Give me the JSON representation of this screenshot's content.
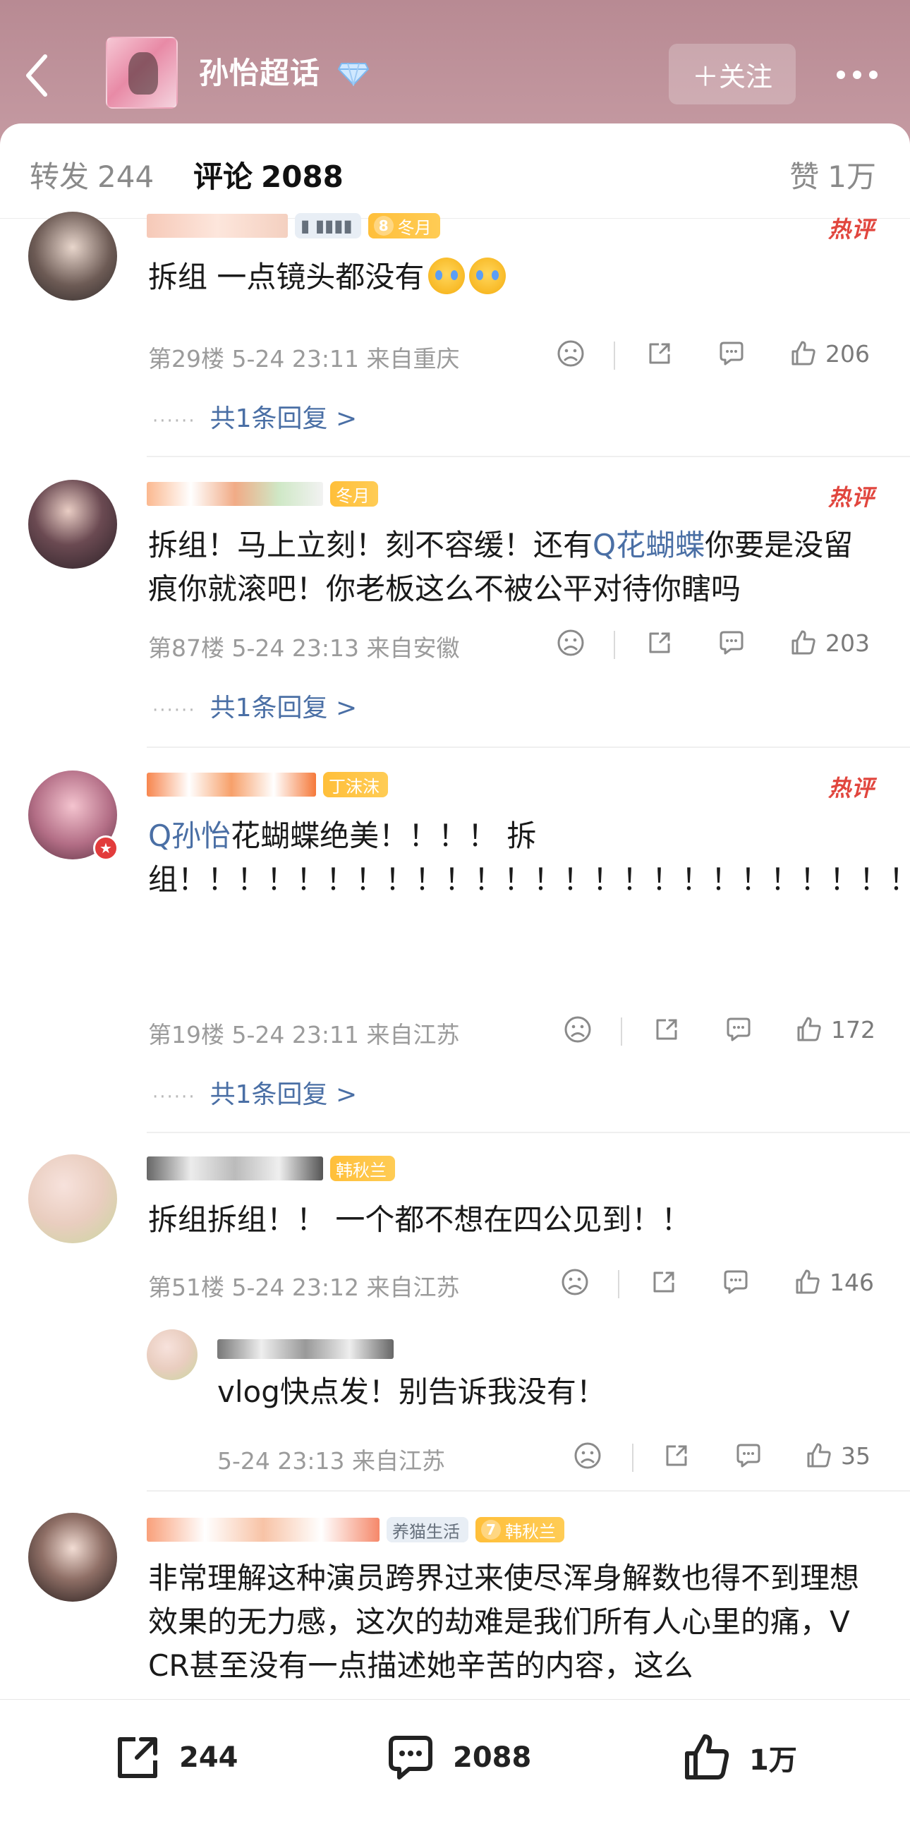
{
  "header": {
    "back_icon": "chevron-left-icon",
    "topic_title": "孙怡超话",
    "topic_badge_icon": "diamond-icon",
    "follow_label": "＋关注",
    "more_icon": "more-dots-icon"
  },
  "tabs": {
    "repost": {
      "label": "转发",
      "count": "244"
    },
    "comment": {
      "label": "评论",
      "count": "2088"
    },
    "like": {
      "label": "赞",
      "count": "1万"
    }
  },
  "hot_label": "热评",
  "comments": [
    {
      "badges": [
        {
          "level": "8",
          "text": "冬月"
        }
      ],
      "text": "拆组 一点镜头都没有",
      "meta": "第29楼 5-24 23:11 来自重庆",
      "likes": "206",
      "replies": "共1条回复 >"
    },
    {
      "badges": [
        {
          "text": "冬月"
        }
      ],
      "text_a": "拆组！马上立刻！刻不容缓！还有",
      "mention": "Q花蝴蝶",
      "text_b": "你要是没留痕你就滚吧！你老板这么不被公平对待你瞎吗",
      "meta": "第87楼 5-24 23:13 来自安徽",
      "likes": "203",
      "replies": "共1条回复 >"
    },
    {
      "badges": [
        {
          "text": "丁沫沫"
        }
      ],
      "mention": "Q孙怡",
      "text": "花蝴蝶绝美！！！！ 拆组！！！！！！！！！！！！！！！！！！！！！！！！！！！！！！！！！！！！！！！！！！！！！！！！！！！！！！！！！！！！！！！！！！！！！！！！！！！！！！！！！！！！！！！！！！！！！",
      "meta": "第19楼 5-24 23:11 来自江苏",
      "likes": "172",
      "replies": "共1条回复 >"
    },
    {
      "badges": [
        {
          "text": "韩秋兰"
        }
      ],
      "text": "拆组拆组！！ 一个都不想在四公见到！！",
      "meta": "第51楼 5-24 23:12 来自江苏",
      "likes": "146",
      "reply": {
        "text": "vlog快点发！别告诉我没有！",
        "meta": "5-24 23:13 来自江苏",
        "likes": "35"
      }
    },
    {
      "badges": [
        {
          "text": "养猫生活"
        },
        {
          "level": "7",
          "text": "韩秋兰"
        }
      ],
      "text": "非常理解这种演员跨界过来使尽浑身解数也得不到理想效果的无力感，这次的劫难是我们所有人心里的痛，VCR甚至没有一点描述她辛苦的内容，这么"
    }
  ],
  "bottom_bar": {
    "repost_count": "244",
    "comment_count": "2088",
    "like_count": "1万"
  },
  "colors": {
    "header": "#bf939b",
    "accent_blue": "#4a6fa5",
    "hot_red": "#e1463e",
    "badge_gold": "#ffbf3a"
  }
}
